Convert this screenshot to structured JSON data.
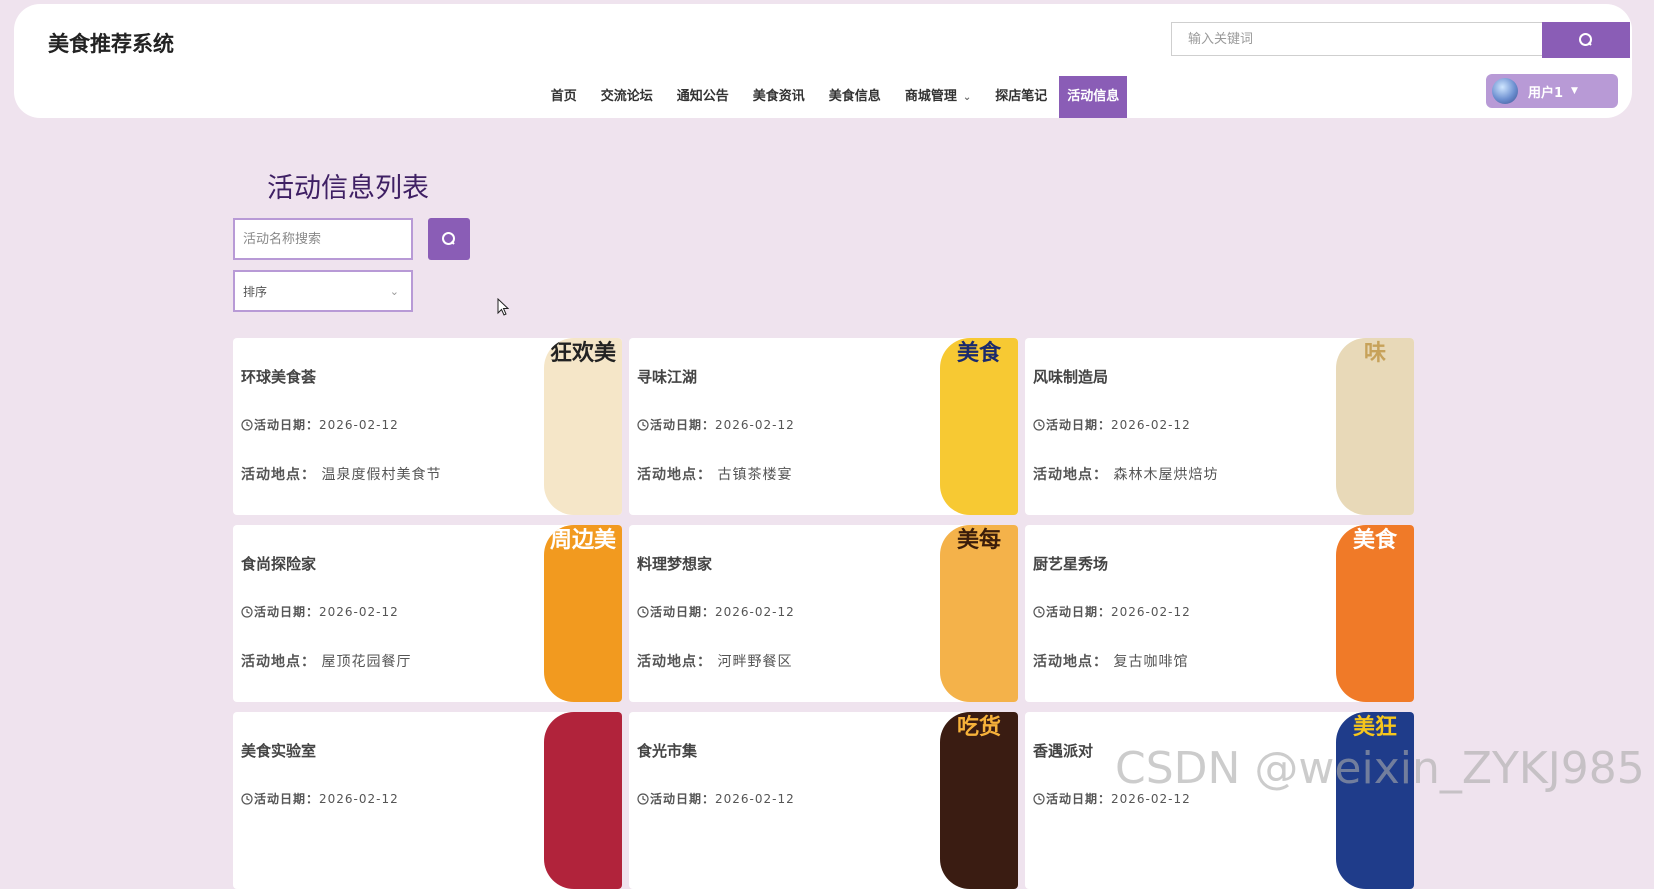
{
  "header": {
    "brand": "美食推荐系统",
    "search_placeholder": "输入关键词"
  },
  "nav": {
    "items": [
      {
        "label": "首页"
      },
      {
        "label": "交流论坛"
      },
      {
        "label": "通知公告"
      },
      {
        "label": "美食资讯"
      },
      {
        "label": "美食信息"
      },
      {
        "label": "商城管理"
      },
      {
        "label": "探店笔记"
      },
      {
        "label": "活动信息"
      }
    ],
    "active": "活动信息"
  },
  "user": {
    "name": "用户1"
  },
  "page": {
    "title": "活动信息列表",
    "name_search_placeholder": "活动名称搜索",
    "sort_label": "排序"
  },
  "labels": {
    "date_label": "活动日期：",
    "location_label": "活动地点："
  },
  "cards": [
    {
      "title": "环球美食荟",
      "date": "2026-02-12",
      "location": "温泉度假村美食节",
      "img_text": "狂欢美",
      "img_bg": "#f5e6c8",
      "img_fg": "#222"
    },
    {
      "title": "寻味江湖",
      "date": "2026-02-12",
      "location": "古镇茶楼宴",
      "img_text": "美食",
      "img_bg": "#f7c933",
      "img_fg": "#1a2a6c"
    },
    {
      "title": "风味制造局",
      "date": "2026-02-12",
      "location": "森林木屋烘焙坊",
      "img_text": "味",
      "img_bg": "#e8d9b8",
      "img_fg": "#c7a25a"
    },
    {
      "title": "食尚探险家",
      "date": "2026-02-12",
      "location": "屋顶花园餐厅",
      "img_text": "周边美",
      "img_bg": "#f29a1f",
      "img_fg": "#fff"
    },
    {
      "title": "料理梦想家",
      "date": "2026-02-12",
      "location": "河畔野餐区",
      "img_text": "美每",
      "img_bg": "#f4b24a",
      "img_fg": "#3b1d0a"
    },
    {
      "title": "厨艺星秀场",
      "date": "2026-02-12",
      "location": "复古咖啡馆",
      "img_text": "美食",
      "img_bg": "#f07a28",
      "img_fg": "#fff"
    },
    {
      "title": "美食实验室",
      "date": "2026-02-12",
      "location": "",
      "img_text": "",
      "img_bg": "#b1233b",
      "img_fg": "#fff"
    },
    {
      "title": "食光市集",
      "date": "2026-02-12",
      "location": "",
      "img_text": "吃货",
      "img_bg": "#3a1c12",
      "img_fg": "#f7b23a"
    },
    {
      "title": "香遇派对",
      "date": "2026-02-12",
      "location": "",
      "img_text": "美狂",
      "img_bg": "#1f3c8a",
      "img_fg": "#f6c61c"
    }
  ],
  "watermark": "CSDN @weixin_ZYKJ985",
  "colors": {
    "accent": "#8a5db6",
    "page_bg": "#efe3ee",
    "title": "#3f2064"
  }
}
